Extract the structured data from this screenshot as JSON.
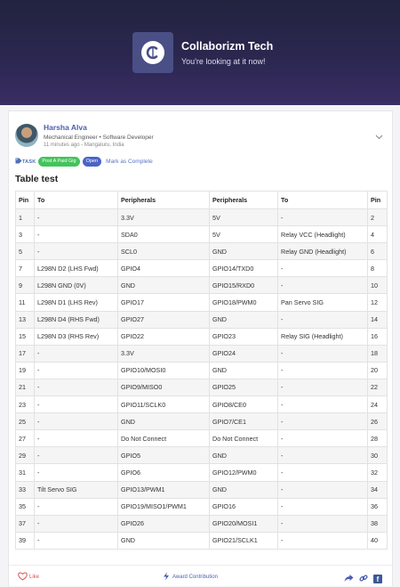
{
  "header": {
    "brand_name": "Collaborizm Tech",
    "tagline": "You're looking at it now!"
  },
  "post": {
    "author_name": "Harsha Alva",
    "author_role": "Mechanical Engineer • Software Developer",
    "author_meta": "11 minutes ago - Mangaluru, India",
    "task_label": "TASK",
    "paid_gig_label": "Post A Paid Gig",
    "status_label": "Open",
    "mark_complete_label": "Mark as Complete",
    "title": "Table test"
  },
  "table": {
    "headers": [
      "Pin",
      "To",
      "Peripherals",
      "Peripherals",
      "To",
      "Pin"
    ],
    "rows": [
      [
        "1",
        "-",
        "3.3V",
        "5V",
        "-",
        "2"
      ],
      [
        "3",
        "-",
        "SDA0",
        "5V",
        "Relay VCC (Headlight)",
        "4"
      ],
      [
        "5",
        "-",
        "SCL0",
        "GND",
        "Relay GND (Headlight)",
        "6"
      ],
      [
        "7",
        "L298N D2 (LHS Fwd)",
        "GPIO4",
        "GPIO14/TXD0",
        "-",
        "8"
      ],
      [
        "9",
        "L298N GND (0V)",
        "GND",
        "GPIO15/RXD0",
        "-",
        "10"
      ],
      [
        "11",
        "L298N D1 (LHS Rev)",
        "GPIO17",
        "GPIO18/PWM0",
        "Pan Servo SIG",
        "12"
      ],
      [
        "13",
        "L298N D4 (RHS Fwd)",
        "GPIO27",
        "GND",
        "-",
        "14"
      ],
      [
        "15",
        "L298N D3 (RHS Rev)",
        "GPIO22",
        "GPIO23",
        "Relay SIG (Headlight)",
        "16"
      ],
      [
        "17",
        "-",
        "3.3V",
        "GPIO24",
        "-",
        "18"
      ],
      [
        "19",
        "-",
        "GPIO10/MOSI0",
        "GND",
        "-",
        "20"
      ],
      [
        "21",
        "-",
        "GPIO9/MISO0",
        "GPIO25",
        "-",
        "22"
      ],
      [
        "23",
        "-",
        "GPIO11/SCLK0",
        "GPIO8/CE0",
        "-",
        "24"
      ],
      [
        "25",
        "-",
        "GND",
        "GPIO7/CE1",
        "-",
        "26"
      ],
      [
        "27",
        "-",
        "Do Not Connect",
        "Do Not Connect",
        "-",
        "28"
      ],
      [
        "29",
        "-",
        "GPIO5",
        "GND",
        "-",
        "30"
      ],
      [
        "31",
        "-",
        "GPIO6",
        "GPIO12/PWM0",
        "-",
        "32"
      ],
      [
        "33",
        "Tilt Servo SIG",
        "GPIO13/PWM1",
        "GND",
        "-",
        "34"
      ],
      [
        "35",
        "-",
        "GPIO19/MISO1/PWM1",
        "GPIO16",
        "-",
        "36"
      ],
      [
        "37",
        "-",
        "GPIO26",
        "GPIO20/MOSI1",
        "-",
        "38"
      ],
      [
        "39",
        "-",
        "GND",
        "GPIO21/SCLK1",
        "-",
        "40"
      ]
    ]
  },
  "footer": {
    "like_label": "Like",
    "award_label": "Award Contribution"
  },
  "icons": {
    "logo": "collaborizm-logo-icon",
    "chevron": "chevron-down-icon",
    "tag": "tag-icon",
    "heart": "heart-icon",
    "award": "award-icon",
    "share": "share-icon",
    "link": "link-icon",
    "facebook": "facebook-icon"
  },
  "colors": {
    "banner_top": "#22233f",
    "banner_bottom": "#3a2d63",
    "accent_blue": "#4a5fb0",
    "pill_green": "#43c45a",
    "pill_blue": "#4a64c8",
    "like_red": "#d9534f"
  }
}
